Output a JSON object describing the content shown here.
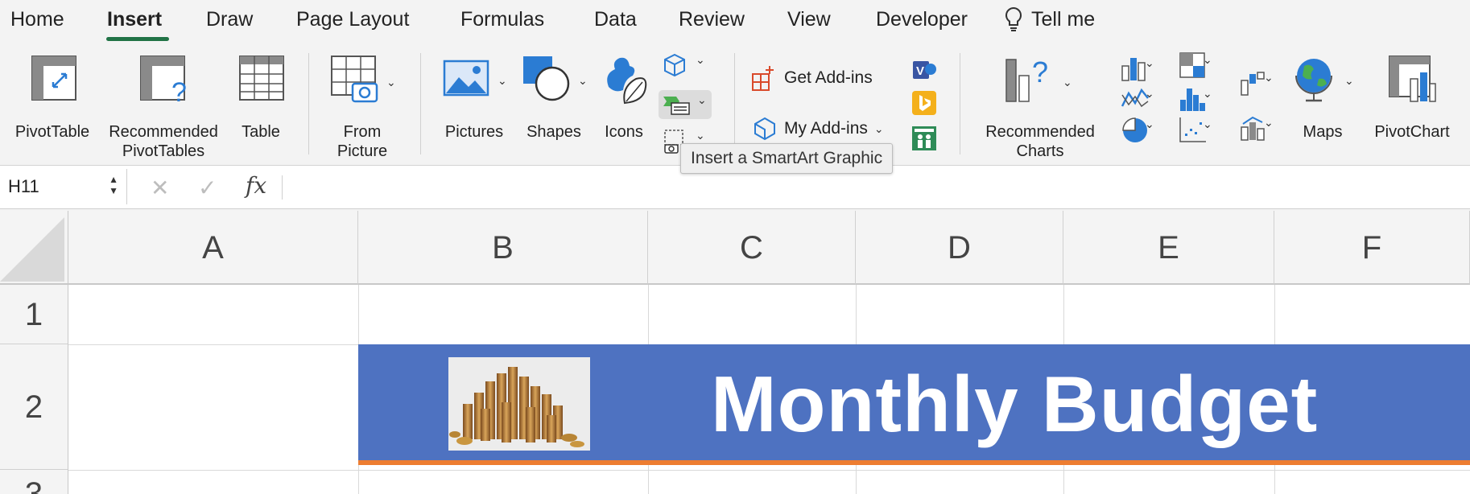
{
  "tabs": [
    {
      "label": "Home",
      "active": false
    },
    {
      "label": "Insert",
      "active": true
    },
    {
      "label": "Draw",
      "active": false
    },
    {
      "label": "Page Layout",
      "active": false
    },
    {
      "label": "Formulas",
      "active": false
    },
    {
      "label": "Data",
      "active": false
    },
    {
      "label": "Review",
      "active": false
    },
    {
      "label": "View",
      "active": false
    },
    {
      "label": "Developer",
      "active": false
    }
  ],
  "tell_me": "Tell me",
  "ribbon": {
    "pivottable": "PivotTable",
    "recommended_pivottables_1": "Recommended",
    "recommended_pivottables_2": "PivotTables",
    "table": "Table",
    "from_picture_1": "From",
    "from_picture_2": "Picture",
    "pictures": "Pictures",
    "shapes": "Shapes",
    "icons": "Icons",
    "get_addins": "Get Add-ins",
    "my_addins": "My Add-ins",
    "recommended_charts_1": "Recommended",
    "recommended_charts_2": "Charts",
    "maps": "Maps",
    "pivotchart": "PivotChart"
  },
  "tooltip": "Insert a SmartArt Graphic",
  "formula_bar": {
    "name_box": "H11",
    "formula": ""
  },
  "columns": [
    "A",
    "B",
    "C",
    "D",
    "E",
    "F"
  ],
  "rows": [
    "1",
    "2",
    "3"
  ],
  "banner": {
    "title": "Monthly Budget"
  },
  "colors": {
    "accent_green": "#217346",
    "banner_blue": "#4e72c1",
    "banner_orange": "#ed7d31"
  }
}
